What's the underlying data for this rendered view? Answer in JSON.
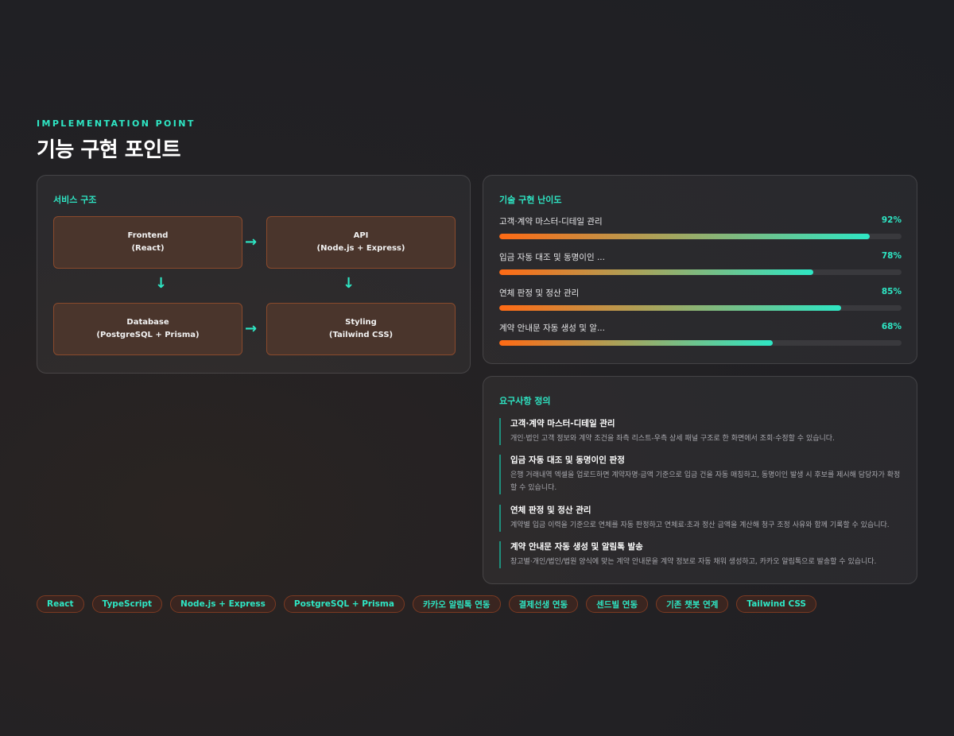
{
  "header": {
    "eyebrow": "IMPLEMENTATION POINT",
    "title": "기능 구현 포인트"
  },
  "architecture": {
    "title": "서비스 구조",
    "nodes": [
      {
        "name": "Frontend",
        "detail": "(React)"
      },
      {
        "name": "API",
        "detail": "(Node.js + Express)"
      },
      {
        "name": "Database",
        "detail": "(PostgreSQL + Prisma)"
      },
      {
        "name": "Styling",
        "detail": "(Tailwind CSS)"
      }
    ],
    "arrow_right": "→",
    "arrow_down": "↓"
  },
  "skills": {
    "title": "기술 구현 난이도",
    "items": [
      {
        "label": "고객·계약 마스터-디테일 관리",
        "percent_text": "92%",
        "value": 92
      },
      {
        "label": "입금 자동 대조 및 동명이인 ...",
        "percent_text": "78%",
        "value": 78
      },
      {
        "label": "연체 판정 및 정산 관리",
        "percent_text": "85%",
        "value": 85
      },
      {
        "label": "계약 안내문 자동 생성 및 알...",
        "percent_text": "68%",
        "value": 68
      }
    ]
  },
  "requirements": {
    "title": "요구사항 정의",
    "items": [
      {
        "title": "고객·계약 마스터-디테일 관리",
        "desc": "개인·법인 고객 정보와 계약 조건을 좌측 리스트-우측 상세 패널 구조로 한 화면에서 조회·수정할 수 있습니다."
      },
      {
        "title": "입금 자동 대조 및 동명이인 판정",
        "desc": "은행 거래내역 엑셀을 업로드하면 계약자명·금액 기준으로 입금 건을 자동 매칭하고, 동명이인 발생 시 후보를 제시해 담당자가 확정할 수 있습니다."
      },
      {
        "title": "연체 판정 및 정산 관리",
        "desc": "계약별 입금 이력을 기준으로 연체를 자동 판정하고 연체료·초과 정산 금액을 계산해 청구 조정 사유와 함께 기록할 수 있습니다."
      },
      {
        "title": "계약 안내문 자동 생성 및 알림톡 발송",
        "desc": "창고별·개인/법인/법원 양식에 맞는 계약 안내문을 계약 정보로 자동 채워 생성하고, 카카오 알림톡으로 발송할 수 있습니다."
      }
    ]
  },
  "tags": [
    "React",
    "TypeScript",
    "Node.js + Express",
    "PostgreSQL + Prisma",
    "카카오 알림톡 연동",
    "결제선생 연동",
    "센드빌 연동",
    "기존 챗봇 연계",
    "Tailwind CSS"
  ],
  "colors": {
    "accent": "#2ee6c4",
    "bar_start": "#ff6a14",
    "node_bg": "#4a352c",
    "node_border": "#8a4a2c"
  }
}
